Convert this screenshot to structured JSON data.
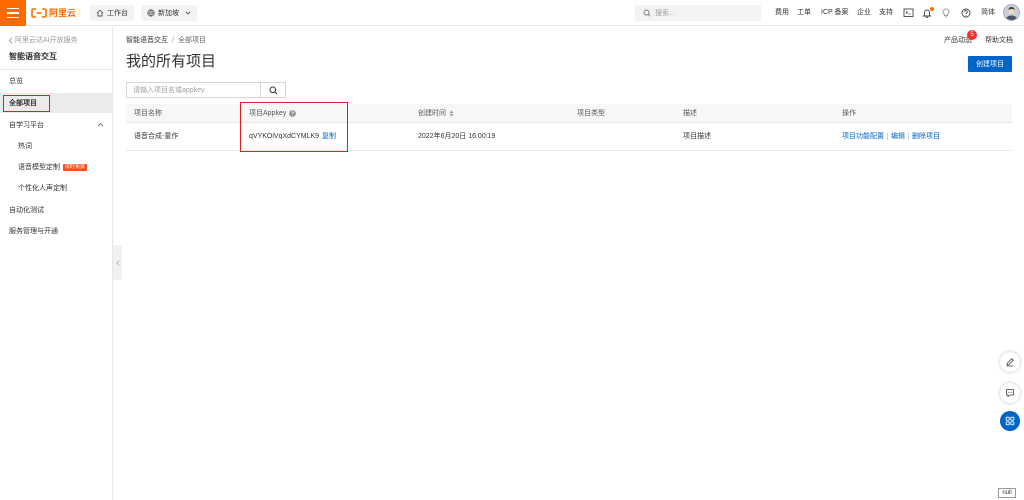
{
  "topbar": {
    "logo_text": "阿里云",
    "workbench_label": "工作台",
    "region_label": "新加坡",
    "search_placeholder": "搜索...",
    "links": {
      "billing": "费用",
      "ticket": "工单",
      "icp": "ICP 备案",
      "enterprise": "企业",
      "support": "支持"
    },
    "lang_label": "简体",
    "icons": [
      "menu-icon",
      "aliyun-logo-icon",
      "home-icon",
      "globe-icon",
      "chevron-down-icon",
      "search-icon",
      "terminal-icon",
      "bell-icon",
      "lightbulb-icon",
      "help-icon",
      "avatar"
    ]
  },
  "sidebar": {
    "back_label": "阿里云达AI开放服务",
    "product_title": "智能语音交互",
    "items": [
      {
        "label": "总览"
      },
      {
        "label": "全部项目",
        "selected": true
      },
      {
        "label": "自学习平台",
        "expanded": true
      },
      {
        "label": "热词"
      },
      {
        "label": "语音模型定制",
        "badge": "限时免费"
      },
      {
        "label": "个性化人声定制"
      },
      {
        "label": "自动化测试"
      },
      {
        "label": "服务管理与开通"
      }
    ]
  },
  "header": {
    "breadcrumb": [
      "智能语音交互",
      "全部项目"
    ],
    "breadcrumb_separator": "/",
    "product_news_label": "产品动态",
    "product_news_count": "5",
    "help_docs_label": "帮助文档",
    "page_title": "我的所有项目",
    "create_button_label": "创建项目"
  },
  "search": {
    "placeholder": "请输入项目名或appkey"
  },
  "table": {
    "columns": [
      "项目名称",
      "项目Appkey",
      "创建时间",
      "项目类型",
      "描述",
      "操作"
    ],
    "rows": [
      {
        "name": "语音合成-童作",
        "appkey": "qVYKOiVqXdCYMLK9",
        "copy_label": "复制",
        "created": "2022年6月20日 16:00:19",
        "type": "",
        "description": "项目描述",
        "actions": [
          "项目功能配置",
          "编辑",
          "删除项目"
        ]
      }
    ]
  },
  "floating": {
    "icons": [
      "edit-icon",
      "chat-icon",
      "grid-icon"
    ],
    "null_label": "null"
  },
  "colors": {
    "brand_orange": "#ff6a00",
    "link_blue": "#0064c8",
    "annotation_red": "#e02020",
    "badge_red": "#f23030"
  }
}
